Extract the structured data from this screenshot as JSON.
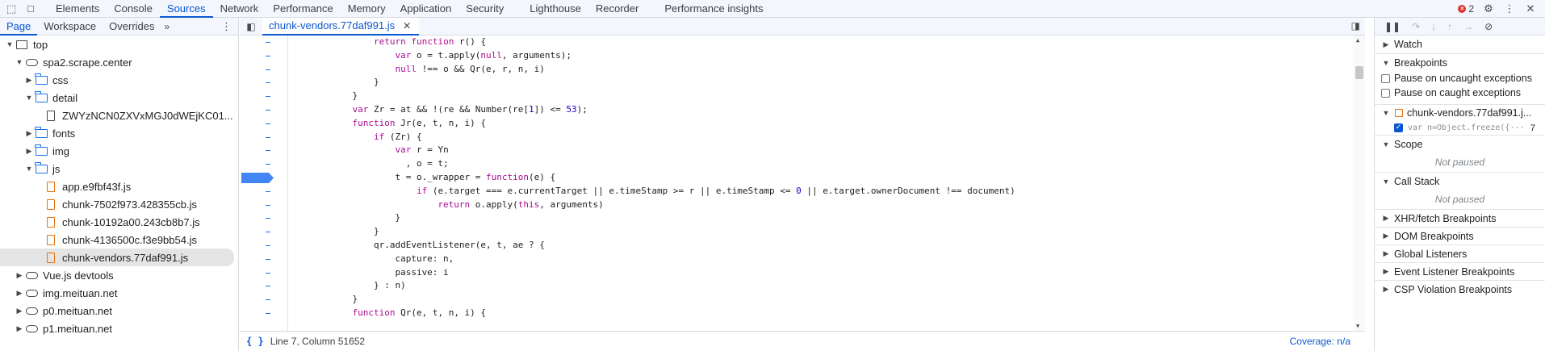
{
  "toolbar": {
    "inspect_icon": "inspect-element-icon",
    "device_icon": "device-toggle-icon",
    "tabs": [
      "Elements",
      "Console",
      "Sources",
      "Network",
      "Performance",
      "Memory",
      "Application",
      "Security",
      "Lighthouse",
      "Recorder",
      "Performance insights"
    ],
    "active_tab": "Sources",
    "error_count": "2"
  },
  "navigator": {
    "tabs": [
      "Page",
      "Workspace",
      "Overrides"
    ],
    "more": "»",
    "tree": [
      {
        "label": "top",
        "depth": 0,
        "icon": "frame",
        "expanded": true
      },
      {
        "label": "spa2.scrape.center",
        "depth": 1,
        "icon": "cloud",
        "expanded": true
      },
      {
        "label": "css",
        "depth": 2,
        "icon": "folder",
        "expanded": false
      },
      {
        "label": "detail",
        "depth": 2,
        "icon": "folder",
        "expanded": true
      },
      {
        "label": "ZWYzNCN0ZXVxMGJ0dWEjKC01...",
        "depth": 3,
        "icon": "doc",
        "expanded": null
      },
      {
        "label": "fonts",
        "depth": 2,
        "icon": "folder",
        "expanded": false
      },
      {
        "label": "img",
        "depth": 2,
        "icon": "folder",
        "expanded": false
      },
      {
        "label": "js",
        "depth": 2,
        "icon": "folder",
        "expanded": true
      },
      {
        "label": "app.e9fbf43f.js",
        "depth": 3,
        "icon": "jsdoc",
        "expanded": null
      },
      {
        "label": "chunk-7502f973.428355cb.js",
        "depth": 3,
        "icon": "jsdoc",
        "expanded": null
      },
      {
        "label": "chunk-10192a00.243cb8b7.js",
        "depth": 3,
        "icon": "jsdoc",
        "expanded": null
      },
      {
        "label": "chunk-4136500c.f3e9bb54.js",
        "depth": 3,
        "icon": "jsdoc",
        "expanded": null
      },
      {
        "label": "chunk-vendors.77daf991.js",
        "depth": 3,
        "icon": "jsdoc",
        "expanded": null,
        "selected": true
      },
      {
        "label": "Vue.js devtools",
        "depth": 1,
        "icon": "cloud",
        "expanded": false
      },
      {
        "label": "img.meituan.net",
        "depth": 1,
        "icon": "cloud",
        "expanded": false
      },
      {
        "label": "p0.meituan.net",
        "depth": 1,
        "icon": "cloud",
        "expanded": false
      },
      {
        "label": "p1.meituan.net",
        "depth": 1,
        "icon": "cloud",
        "expanded": false
      }
    ]
  },
  "editor": {
    "file_tab": "chunk-vendors.77daf991.js",
    "status_position": "Line 7, Column 51652",
    "coverage": "Coverage: n/a",
    "lines": [
      "                return function r() {",
      "                    var o = t.apply(null, arguments);",
      "                    null !== o && Qr(e, r, n, i)",
      "                }",
      "            }",
      "            var Zr = at && !(re && Number(re[1]) <= 53);",
      "            function Jr(e, t, n, i) {",
      "                if (Zr) {",
      "                    var r = Yn",
      "                      , o = t;",
      "                    t = o._wrapper = function(e) {",
      "                        if (e.target === e.currentTarget || e.timeStamp >= r || e.timeStamp <= 0 || e.target.ownerDocument !== document)",
      "                            return o.apply(this, arguments)",
      "                    }",
      "                }",
      "                qr.addEventListener(e, t, ae ? {",
      "                    capture: n,",
      "                    passive: i",
      "                } : n)",
      "            }",
      "            function Qr(e, t, n, i) {"
    ],
    "breakpoint_line_index": 10
  },
  "debugger": {
    "sections": {
      "watch": "Watch",
      "breakpoints": "Breakpoints",
      "pause_uncaught": "Pause on uncaught exceptions",
      "pause_caught": "Pause on caught exceptions",
      "bp_file": "chunk-vendors.77daf991.j...",
      "bp_code": "var n=Object.freeze({···",
      "bp_line": "7",
      "scope": "Scope",
      "not_paused_1": "Not paused",
      "call_stack": "Call Stack",
      "not_paused_2": "Not paused",
      "xhr": "XHR/fetch Breakpoints",
      "dom": "DOM Breakpoints",
      "global": "Global Listeners",
      "event": "Event Listener Breakpoints",
      "csp": "CSP Violation Breakpoints"
    }
  }
}
